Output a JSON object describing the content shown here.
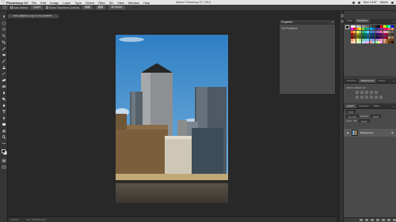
{
  "menubar": {
    "app_name": "Photoshop CC",
    "items": [
      "File",
      "Edit",
      "Image",
      "Layer",
      "Type",
      "Select",
      "Filter",
      "3D",
      "View",
      "Window",
      "Help"
    ],
    "center_title": "Adobe Photoshop CC 2015",
    "clock": "Mon 13:57",
    "user": "Admin"
  },
  "optionsbar": {
    "auto_select_label": "Auto-Select:",
    "auto_select_value": "Layer",
    "transform_label": "Show Transform Controls",
    "mode_3d": "3D Mode:"
  },
  "document": {
    "tab_label": "DOCUMENT.psd @ 16.7% (RGB/8*)",
    "zoom": "16.67%",
    "doc_size": "Doc: 34.3M/34.3M"
  },
  "properties_panel": {
    "title": "Properties",
    "empty_text": "No Properties"
  },
  "swatches_panel": {
    "tabs": [
      "Color",
      "Swatches"
    ],
    "active_tab": 1,
    "colors": [
      "#ffffff",
      "#e6e6e6",
      "#cccccc",
      "#b3b3b3",
      "#999999",
      "#808080",
      "#666666",
      "#4d4d4d",
      "#333333",
      "#1a1a1a",
      "#000000",
      "#ff0000",
      "#ffff00",
      "#00ff00",
      "#00ffff",
      "#0000ff",
      "#ff00ff",
      "#ed1c24",
      "#f7941d",
      "#fff200",
      "#8dc63f",
      "#00a651",
      "#00a99d",
      "#00aeef",
      "#0072bc",
      "#2e3192",
      "#662d91",
      "#92278f",
      "#ec008c",
      "#ed145b",
      "#f26c4f",
      "#f69679",
      "#f26522",
      "#fbaf5d",
      "#fff568",
      "#acd373",
      "#3cb878",
      "#1cbbb4",
      "#6dcff6",
      "#448ccb",
      "#5674b9",
      "#8560a8",
      "#a864a8",
      "#f06eaa",
      "#f49ac2",
      "#c7b299",
      "#998675",
      "#736357",
      "#9e0b0f",
      "#a0410d",
      "#aba000",
      "#598527",
      "#007236",
      "#00746b",
      "#0076a3",
      "#004a80",
      "#003471",
      "#1b1464",
      "#440e62",
      "#630460",
      "#9e005d",
      "#9e0039",
      "#534741",
      "#362f2d",
      "#790000",
      "#7b2e00",
      "#827b00",
      "#406618",
      "#005e20",
      "#005952",
      "#005b7f",
      "#003663",
      "#002157",
      "#0d004c",
      "#32004b",
      "#4b0049",
      "#7b0046",
      "#7a0026",
      "#c69c6d",
      "#a67c52",
      "#f7977a",
      "#fdc68a",
      "#fff79a",
      "#c4df9b",
      "#82ca9c",
      "#7accc8",
      "#6ecff6",
      "#7ea7d8",
      "#8493ca",
      "#a187be",
      "#bc8dbf",
      "#f49ac1",
      "#f5989d",
      "#8c6239",
      "#754c24",
      "#603913",
      "#ffcc99",
      "#ffe6b3",
      "#e6ffb3",
      "#b3ffcc",
      "#b3e6ff",
      "#ccb3ff",
      "#ffb3e6",
      "#ff9999",
      "#99ccff",
      "#99ff99",
      "#ffff99",
      "#ff99ff",
      "#cc9966",
      "#996633",
      "#663300",
      "#330000"
    ]
  },
  "adjustments_panel": {
    "tabs": [
      "Libraries",
      "Adjustments",
      "Styles"
    ],
    "active_tab": 1,
    "hint": "Add an adjustment"
  },
  "layers_panel": {
    "tabs": [
      "Layers",
      "Channels",
      "Paths"
    ],
    "kind_label": "Kind",
    "blend_mode": "Normal",
    "opacity_label": "Opacity:",
    "opacity_value": "100%",
    "lock_label": "Lock:",
    "fill_label": "Fill:",
    "fill_value": "100%",
    "layer_name": "Background"
  },
  "colors": {
    "menubar_bg": "#e6e6e6",
    "app_bg": "#282828",
    "panel_bg": "#4a4a4a",
    "sky": "#3f8fd0"
  }
}
